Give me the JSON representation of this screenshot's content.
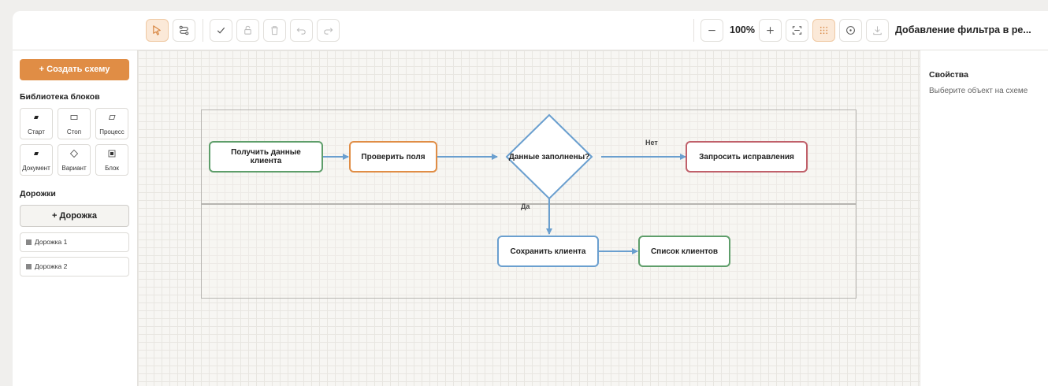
{
  "toolbar": {
    "buttons": {
      "select": "select-icon",
      "connect": "connector-icon",
      "validate": "check-icon",
      "lock": "lock-icon",
      "delete": "trash-icon",
      "undo": "undo-icon",
      "redo": "redo-icon",
      "zoom_out": "minus-icon",
      "zoom_in": "plus-icon",
      "fit": "fit-screen-icon",
      "grid": "grid-icon",
      "center": "target-icon",
      "download": "download-icon"
    },
    "zoom": "100%",
    "doc_title": "Добавление фильтра в ре..."
  },
  "sidebar": {
    "create_button": "+ Создать схему",
    "library_title": "Библиотека блоков",
    "blocks": [
      {
        "label": "Старт",
        "icon": "start-shape-icon"
      },
      {
        "label": "Стоп",
        "icon": "stop-shape-icon"
      },
      {
        "label": "Процесс",
        "icon": "process-shape-icon"
      },
      {
        "label": "Документ",
        "icon": "document-shape-icon"
      },
      {
        "label": "Вариант",
        "icon": "decision-shape-icon"
      },
      {
        "label": "Блок",
        "icon": "block-shape-icon"
      }
    ],
    "lanes_title": "Дорожки",
    "add_lane_button": "+ Дорожка",
    "lanes": [
      "Дорожка 1",
      "Дорожка 2"
    ]
  },
  "diagram": {
    "nodes": {
      "get_data": "Получить данные клиента",
      "check_fields": "Проверить поля",
      "decision": "Данные заполнены?",
      "request_fix": "Запросить исправления",
      "save_client": "Сохранить клиента",
      "client_list": "Список клиентов"
    },
    "edge_labels": {
      "no": "Нет",
      "yes": "Да"
    },
    "colors": {
      "green": "#5e9e6a",
      "orange": "#e08d45",
      "red": "#c0606a",
      "blue": "#6a9fcf",
      "arrow": "#6a9fcf"
    }
  },
  "properties": {
    "title": "Свойства",
    "hint": "Выберите объект на схеме"
  }
}
